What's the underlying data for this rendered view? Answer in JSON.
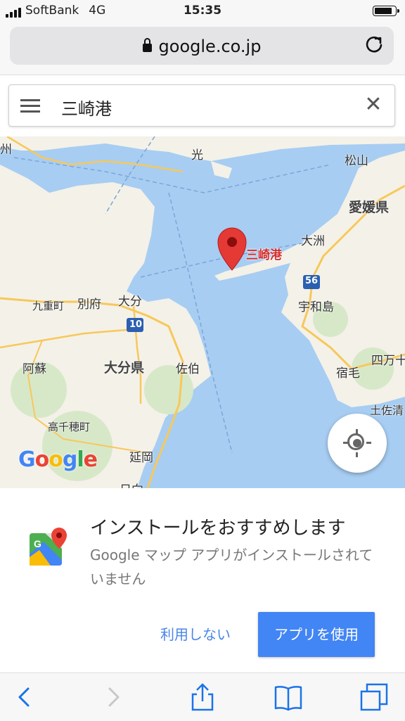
{
  "status_bar": {
    "carrier": "SoftBank",
    "network": "4G",
    "time": "15:35",
    "battery_level": 0.8
  },
  "url_bar": {
    "domain": "google.co.jp",
    "lock_icon": "lock-icon",
    "reload_icon": "reload-icon"
  },
  "search": {
    "menu_icon": "hamburger-icon",
    "query": "三崎港",
    "clear_icon": "close-icon"
  },
  "map": {
    "labels": {
      "shu": "州",
      "hikari": "光",
      "matsuyama": "松山",
      "ehime": "愛媛県",
      "ozu": "大洲",
      "kokudo56": "56",
      "uwajima": "宇和島",
      "kokonoe": "九重町",
      "beppu": "別府",
      "oita": "大分",
      "kokudo10": "10",
      "oita_pref": "大分県",
      "saiki": "佐伯",
      "aso": "阿蘇",
      "sukumo": "宿毛",
      "shimanto": "四万十",
      "takachiho": "高千穂町",
      "tosashimizu": "土佐清",
      "nobeoka": "延岡",
      "bottom_cut": "日向"
    },
    "place_label": "三崎港",
    "logo": "Google",
    "locate_icon": "my-location-icon"
  },
  "install_card": {
    "title": "インストールをおすすめします",
    "description": "Google マップ アプリがインストールされていません",
    "decline_button": "利用しない",
    "use_button": "アプリを使用",
    "accent": "#4285f4"
  },
  "toolbar": {
    "back_icon": "back-icon",
    "forward_icon": "forward-icon",
    "share_icon": "share-icon",
    "bookmarks_icon": "bookmarks-icon",
    "tabs_icon": "tabs-icon"
  }
}
